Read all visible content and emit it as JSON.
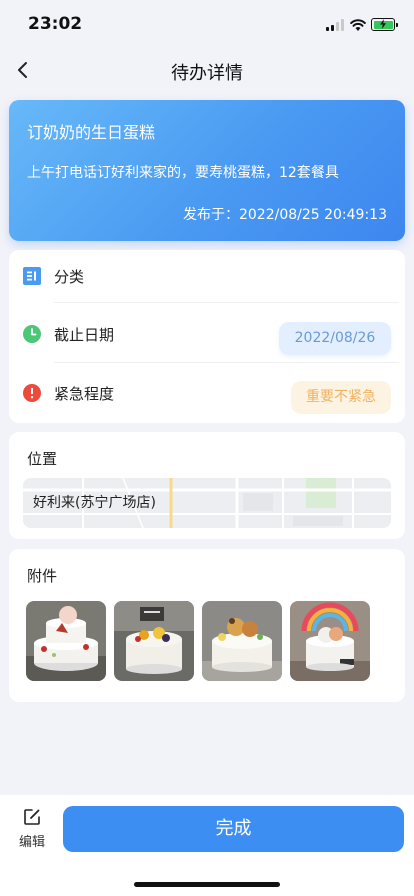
{
  "status_bar": {
    "time": "23:02",
    "icons": [
      "signal-icon",
      "wifi-icon",
      "battery-charging-icon"
    ],
    "battery_color": "#34c759"
  },
  "nav": {
    "title": "待办详情",
    "back_icon": "chevron-left-icon"
  },
  "task": {
    "title": "订奶奶的生日蛋糕",
    "description": "上午打电话订好利来家的，要寿桃蛋糕，12套餐具",
    "published": "发布于：2022/08/25 20:49:13",
    "accent_color": "#3d86ef"
  },
  "info": {
    "rows": [
      {
        "icon": "category-icon",
        "label": "分类",
        "value": ""
      },
      {
        "icon": "clock-icon",
        "label": "截止日期",
        "value": "2022/08/26"
      },
      {
        "icon": "alert-icon",
        "label": "紧急程度",
        "value": "重要不紧急"
      }
    ],
    "icon_colors": {
      "category": "#4a9af2",
      "clock": "#4cc777",
      "alert": "#ec4a3c"
    }
  },
  "location": {
    "section_title": "位置",
    "place": "好利来(苏宁广场店)"
  },
  "attachments": {
    "section_title": "附件",
    "items": [
      "cake-photo-1",
      "cake-photo-2",
      "cake-photo-3",
      "cake-photo-4"
    ]
  },
  "bottom": {
    "edit_label": "编辑",
    "edit_icon": "edit-icon",
    "done_label": "完成",
    "button_color": "#3d8ef3"
  }
}
